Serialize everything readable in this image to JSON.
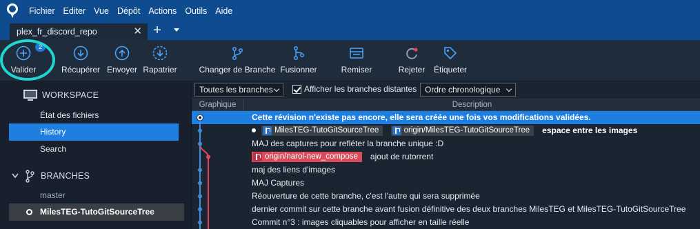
{
  "menu": [
    "Fichier",
    "Editer",
    "Vue",
    "Dépôt",
    "Actions",
    "Outils",
    "Aide"
  ],
  "tab": {
    "title": "plex_fr_discord_repo",
    "close": "✕",
    "add": "+"
  },
  "toolbar": {
    "commit": {
      "label": "Valider",
      "badge": "2"
    },
    "fetch": "Récupérer",
    "push": "Envoyer",
    "pull": "Rapatrier",
    "checkout": "Changer de Branche",
    "merge": "Fusionner",
    "stash": "Remiser",
    "discard": "Rejeter",
    "tag": "Étiqueter"
  },
  "sidebar": {
    "workspace_title": "WORKSPACE",
    "workspace_items": [
      "État des fichiers",
      "History",
      "Search"
    ],
    "active_item": "History",
    "branches_title": "BRANCHES",
    "branches": [
      "master",
      "MilesTEG-TutoGitSourceTree"
    ],
    "current_branch": "MilesTEG-TutoGitSourceTree"
  },
  "filters": {
    "branches_select": "Toutes les branches",
    "show_remote_label": "Afficher les branches distantes",
    "show_remote_checked": true,
    "order_select": "Ordre chronologique"
  },
  "log": {
    "col_graph": "Graphique",
    "col_desc": "Description",
    "rows": [
      {
        "text": "Cette révision n'existe pas encore, elle sera créée une fois vos modifications validées."
      },
      {
        "tags": [
          "MilesTEG-TutoGitSourceTree",
          "origin/MilesTEG-TutoGitSourceTree"
        ],
        "text": "espace entre les images"
      },
      {
        "text": "MAJ des captures pour refléter la branche unique :D"
      },
      {
        "tags": [
          "origin/narol-new_compose"
        ],
        "text": "ajout de rutorrent"
      },
      {
        "text": "maj des liens d'images"
      },
      {
        "text": "MAJ Captures"
      },
      {
        "text": "Réouverture de cette branche, c'est l'autre qui sera supprimée"
      },
      {
        "text": "dernier commit sur cette branche avant fusion définitive des deux branches MilesTEG et MilesTEG-TutoGitSourceTree"
      },
      {
        "text": "Commit n°3 : images cliquables pour afficher en taille réelle"
      }
    ]
  },
  "colors": {
    "menubar": "#0f4c8f",
    "toolbar": "#1f2c3b",
    "sidebar": "#17202c",
    "accent": "#1e7fe0",
    "highlight_ring": "#1fd6d0",
    "graph_blue": "#3c8ee0",
    "graph_red": "#e0455a"
  }
}
